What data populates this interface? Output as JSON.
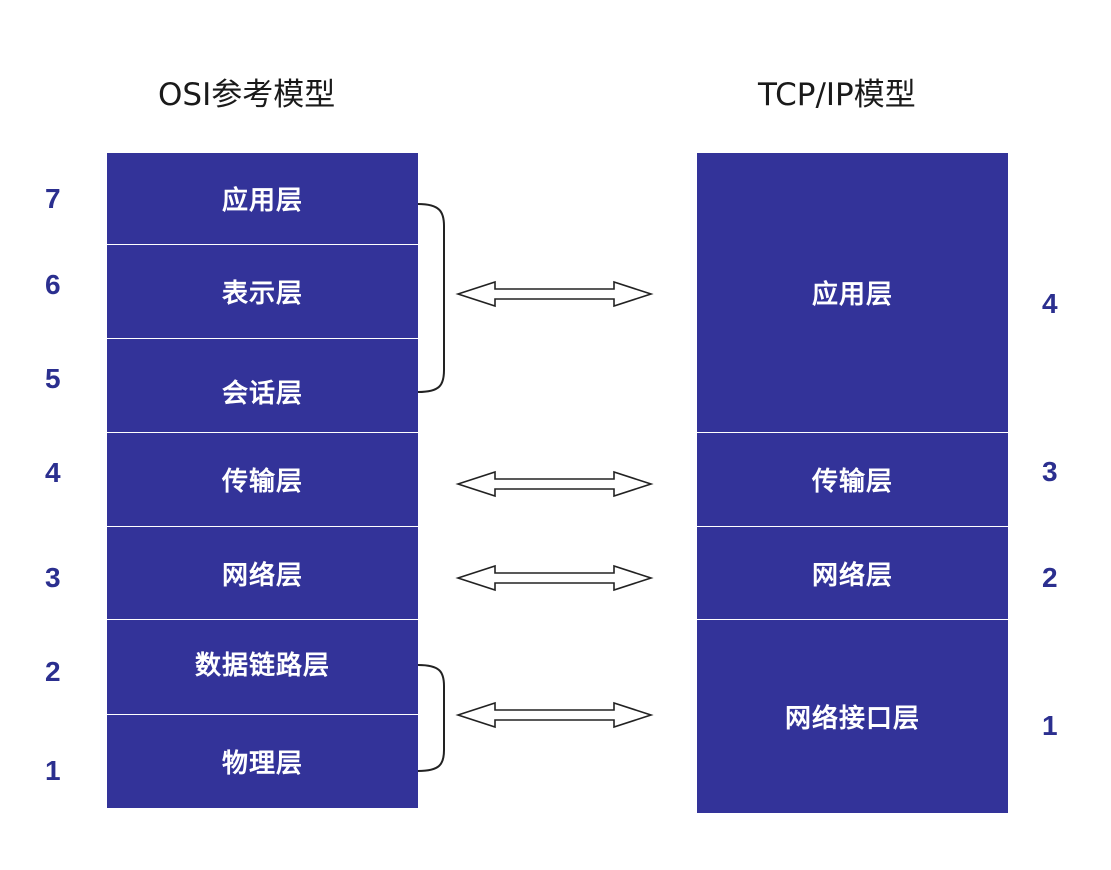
{
  "titles": {
    "osi": "OSI参考模型",
    "tcpip": "TCP/IP模型"
  },
  "colors": {
    "layer_fill": "#333399",
    "divider": "#ffffff",
    "number_text": "#2b2f8f",
    "title_text": "#1a1a1a"
  },
  "osi_layers": [
    {
      "number": "7",
      "name": "应用层"
    },
    {
      "number": "6",
      "name": "表示层"
    },
    {
      "number": "5",
      "name": "会话层"
    },
    {
      "number": "4",
      "name": "传输层"
    },
    {
      "number": "3",
      "name": "网络层"
    },
    {
      "number": "2",
      "name": "数据链路层"
    },
    {
      "number": "1",
      "name": "物理层"
    }
  ],
  "tcpip_layers": [
    {
      "number": "4",
      "name": "应用层"
    },
    {
      "number": "3",
      "name": "传输层"
    },
    {
      "number": "2",
      "name": "网络层"
    },
    {
      "number": "1",
      "name": "网络接口层"
    }
  ],
  "mappings": [
    {
      "osi": [
        "应用层",
        "表示层",
        "会话层"
      ],
      "tcpip": "应用层"
    },
    {
      "osi": [
        "传输层"
      ],
      "tcpip": "传输层"
    },
    {
      "osi": [
        "网络层"
      ],
      "tcpip": "网络层"
    },
    {
      "osi": [
        "数据链路层",
        "物理层"
      ],
      "tcpip": "网络接口层"
    }
  ]
}
